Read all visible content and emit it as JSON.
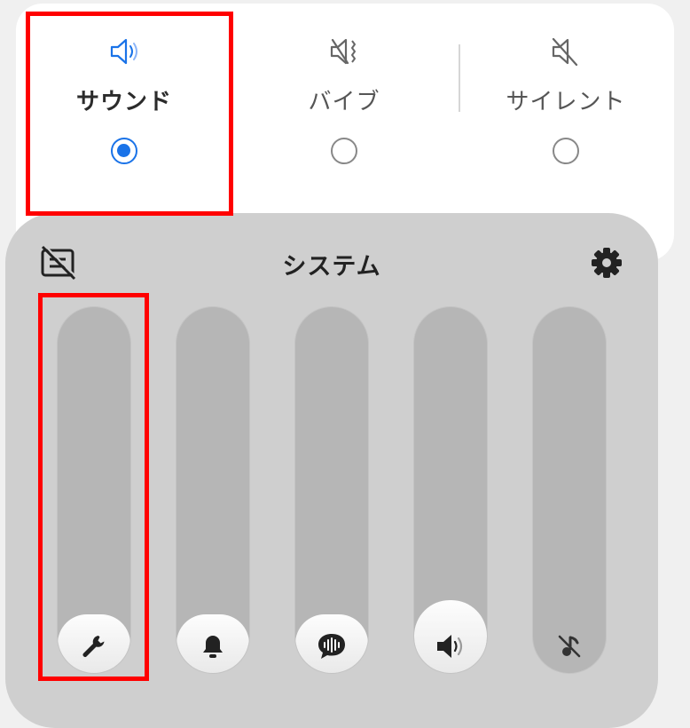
{
  "sound_modes": {
    "items": [
      {
        "label": "サウンド",
        "icon": "speaker-icon",
        "selected": true
      },
      {
        "label": "バイブ",
        "icon": "vibrate-icon",
        "selected": false
      },
      {
        "label": "サイレント",
        "icon": "mute-icon",
        "selected": false
      }
    ]
  },
  "volume_panel": {
    "title": "システム",
    "left_icon": "live-caption-off-icon",
    "right_icon": "gear-icon",
    "sliders": [
      {
        "name": "system",
        "icon": "wrench-icon",
        "level": 0.0
      },
      {
        "name": "ringtone",
        "icon": "bell-icon",
        "level": 0.0
      },
      {
        "name": "notification",
        "icon": "voice-bubble-icon",
        "level": 0.0
      },
      {
        "name": "media",
        "icon": "speaker-icon",
        "level": 0.2
      },
      {
        "name": "muted",
        "icon": "music-off-icon",
        "level": 0.0
      }
    ]
  },
  "colors": {
    "accent": "#1a73e8",
    "highlight": "#ff0000",
    "panel": "#cfcfcf"
  }
}
